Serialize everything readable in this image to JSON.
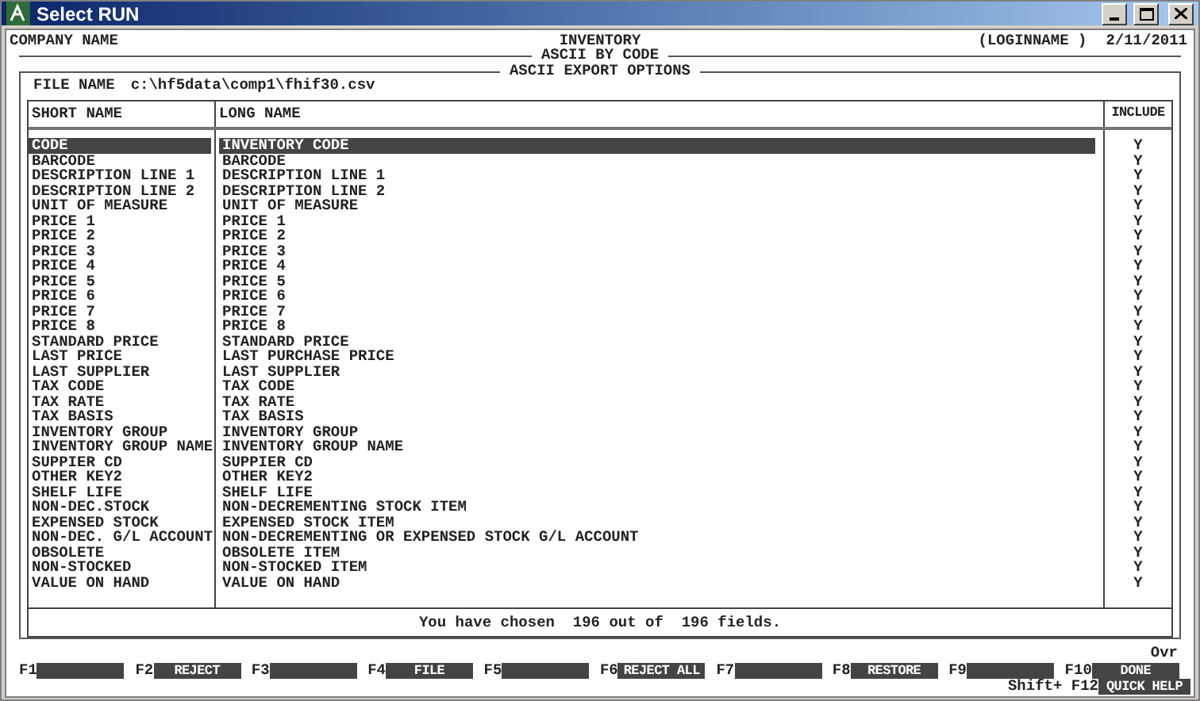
{
  "window": {
    "title": "Select RUN"
  },
  "header": {
    "company": "COMPANY NAME",
    "title": "INVENTORY",
    "login": "(LOGINNAME )",
    "date": "2/11/2011",
    "subtitle": "ASCII BY CODE"
  },
  "panel": {
    "title": "ASCII EXPORT OPTIONS",
    "file_label": "FILE NAME",
    "file_value": "c:\\hf5data\\comp1\\fhif30.csv"
  },
  "table": {
    "columns": [
      "SHORT NAME",
      "LONG NAME",
      "INCLUDE"
    ],
    "rows": [
      {
        "short": "CODE",
        "long": "INVENTORY CODE",
        "include": "Y",
        "selected": true
      },
      {
        "short": "BARCODE",
        "long": "BARCODE",
        "include": "Y",
        "selected": false
      },
      {
        "short": "DESCRIPTION LINE 1",
        "long": "DESCRIPTION LINE 1",
        "include": "Y",
        "selected": false
      },
      {
        "short": "DESCRIPTION LINE 2",
        "long": "DESCRIPTION LINE 2",
        "include": "Y",
        "selected": false
      },
      {
        "short": "UNIT OF MEASURE",
        "long": "UNIT OF MEASURE",
        "include": "Y",
        "selected": false
      },
      {
        "short": "PRICE 1",
        "long": "PRICE 1",
        "include": "Y",
        "selected": false
      },
      {
        "short": "PRICE 2",
        "long": "PRICE 2",
        "include": "Y",
        "selected": false
      },
      {
        "short": "PRICE 3",
        "long": "PRICE 3",
        "include": "Y",
        "selected": false
      },
      {
        "short": "PRICE 4",
        "long": "PRICE 4",
        "include": "Y",
        "selected": false
      },
      {
        "short": "PRICE 5",
        "long": "PRICE 5",
        "include": "Y",
        "selected": false
      },
      {
        "short": "PRICE 6",
        "long": "PRICE 6",
        "include": "Y",
        "selected": false
      },
      {
        "short": "PRICE 7",
        "long": "PRICE 7",
        "include": "Y",
        "selected": false
      },
      {
        "short": "PRICE 8",
        "long": "PRICE 8",
        "include": "Y",
        "selected": false
      },
      {
        "short": "STANDARD PRICE",
        "long": "STANDARD PRICE",
        "include": "Y",
        "selected": false
      },
      {
        "short": "LAST PRICE",
        "long": "LAST PURCHASE PRICE",
        "include": "Y",
        "selected": false
      },
      {
        "short": "LAST SUPPLIER",
        "long": "LAST SUPPLIER",
        "include": "Y",
        "selected": false
      },
      {
        "short": "TAX CODE",
        "long": "TAX CODE",
        "include": "Y",
        "selected": false
      },
      {
        "short": "TAX RATE",
        "long": "TAX RATE",
        "include": "Y",
        "selected": false
      },
      {
        "short": "TAX BASIS",
        "long": "TAX BASIS",
        "include": "Y",
        "selected": false
      },
      {
        "short": "INVENTORY GROUP",
        "long": "INVENTORY GROUP",
        "include": "Y",
        "selected": false
      },
      {
        "short": "INVENTORY GROUP NAME",
        "long": "INVENTORY GROUP NAME",
        "include": "Y",
        "selected": false
      },
      {
        "short": "SUPPIER CD",
        "long": "SUPPIER CD",
        "include": "Y",
        "selected": false
      },
      {
        "short": "OTHER KEY2",
        "long": "OTHER KEY2",
        "include": "Y",
        "selected": false
      },
      {
        "short": "SHELF LIFE",
        "long": "SHELF LIFE",
        "include": "Y",
        "selected": false
      },
      {
        "short": "NON-DEC.STOCK",
        "long": "NON-DECREMENTING STOCK ITEM",
        "include": "Y",
        "selected": false
      },
      {
        "short": "EXPENSED STOCK",
        "long": "EXPENSED STOCK ITEM",
        "include": "Y",
        "selected": false
      },
      {
        "short": "NON-DEC. G/L ACCOUNT",
        "long": "NON-DECREMENTING OR EXPENSED STOCK G/L ACCOUNT",
        "include": "Y",
        "selected": false
      },
      {
        "short": "OBSOLETE",
        "long": "OBSOLETE ITEM",
        "include": "Y",
        "selected": false
      },
      {
        "short": "NON-STOCKED",
        "long": "NON-STOCKED ITEM",
        "include": "Y",
        "selected": false
      },
      {
        "short": "VALUE ON HAND",
        "long": "VALUE ON HAND",
        "include": "Y",
        "selected": false
      }
    ]
  },
  "summary": "You have chosen  **196** out of  **196** fields.",
  "mode": "Ovr",
  "function_keys": [
    {
      "key": "F1"
    },
    {
      "key": "F2",
      "label": "REJECT"
    },
    {
      "key": "F3"
    },
    {
      "key": "F4",
      "label": "FILE"
    },
    {
      "key": "F5"
    },
    {
      "key": "F6",
      "label": "REJECT ALL"
    },
    {
      "key": "F7"
    },
    {
      "key": "F8",
      "label": "RESTORE"
    },
    {
      "key": "F9"
    },
    {
      "key": "F10",
      "label": "DONE"
    }
  ],
  "shift_key": {
    "key": "Shift+ F12",
    "label": "QUICK HELP"
  }
}
